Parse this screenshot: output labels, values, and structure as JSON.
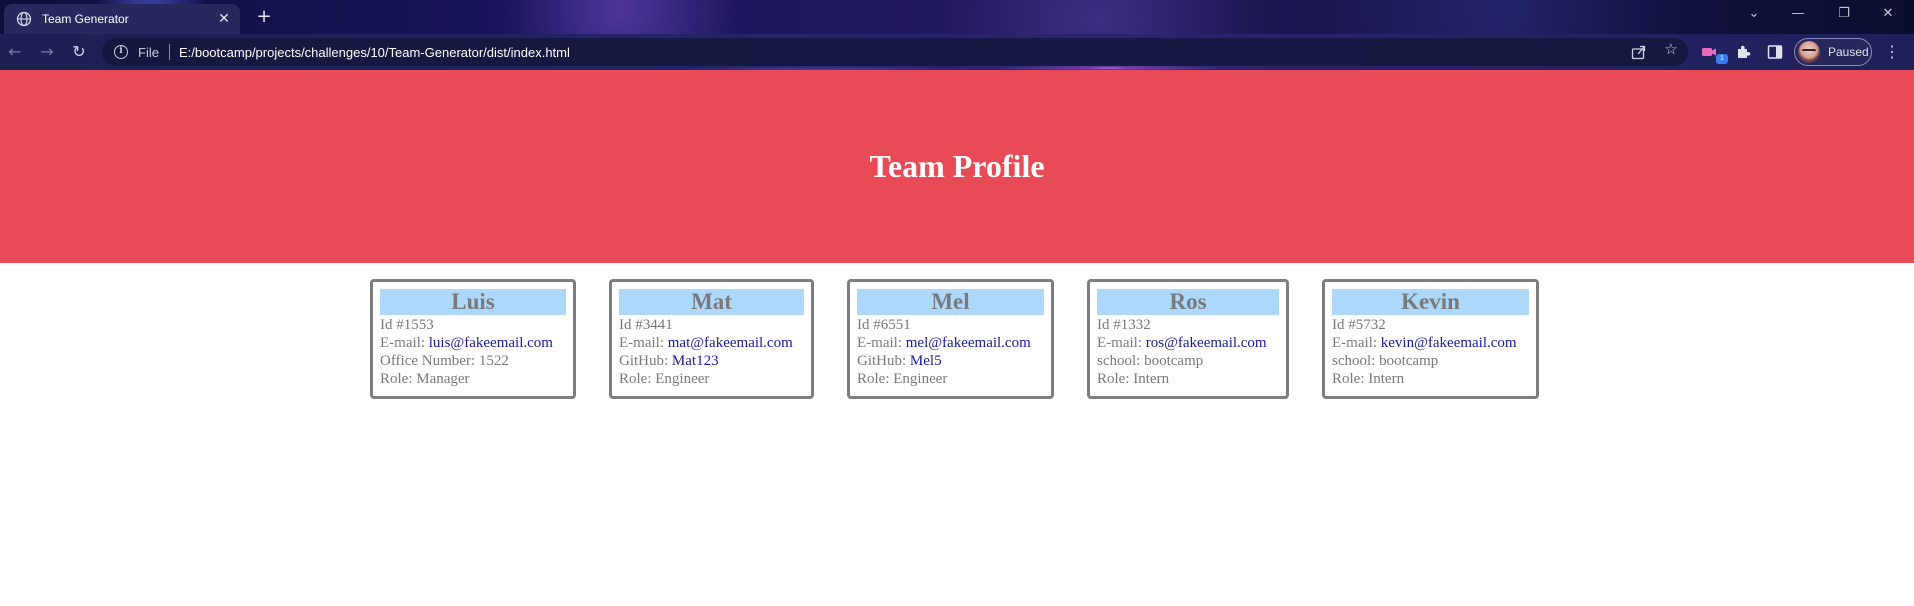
{
  "browser": {
    "tab_title": "Team Generator",
    "tab_close": "✕",
    "new_tab": "+",
    "window_controls": {
      "dropdown": "⌄",
      "minimize": "—",
      "restore": "❐",
      "close": "✕"
    },
    "nav": {
      "back": "←",
      "forward": "→",
      "reload": "↻"
    },
    "scheme_label": "File",
    "url": "E:/bootcamp/projects/challenges/10/Team-Generator/dist/index.html",
    "extension_badge": "1",
    "profile_status": "Paused",
    "menu": "⋮"
  },
  "page": {
    "title": "Team Profile",
    "cards": [
      {
        "name": "Luis",
        "id": "Id #1553",
        "email_label": "E-mail: ",
        "email": "luis@fakeemail.com",
        "extra_label": "Office Number: ",
        "extra_value": "1522",
        "extra_is_link": false,
        "role": "Role: Manager"
      },
      {
        "name": "Mat",
        "id": "Id #3441",
        "email_label": "E-mail: ",
        "email": "mat@fakeemail.com",
        "extra_label": "GitHub: ",
        "extra_value": "Mat123",
        "extra_is_link": true,
        "role": "Role: Engineer"
      },
      {
        "name": "Mel",
        "id": "Id #6551",
        "email_label": "E-mail: ",
        "email": "mel@fakeemail.com",
        "extra_label": "GitHub: ",
        "extra_value": "Mel5",
        "extra_is_link": true,
        "role": "Role: Engineer"
      },
      {
        "name": "Ros",
        "id": "Id #1332",
        "email_label": "E-mail: ",
        "email": "ros@fakeemail.com",
        "extra_label": "school: ",
        "extra_value": "bootcamp",
        "extra_is_link": false,
        "role": "Role: Intern"
      },
      {
        "name": "Kevin",
        "id": "Id #5732",
        "email_label": "E-mail: ",
        "email": "kevin@fakeemail.com",
        "extra_label": "school: ",
        "extra_value": "bootcamp",
        "extra_is_link": false,
        "role": "Role: Intern"
      }
    ]
  },
  "colors": {
    "hero_background": "#e84a56",
    "card_header_background": "#acd8fc",
    "card_border": "#7d7d7d",
    "link": "#1a1aa6",
    "text": "#7a7a7a"
  }
}
